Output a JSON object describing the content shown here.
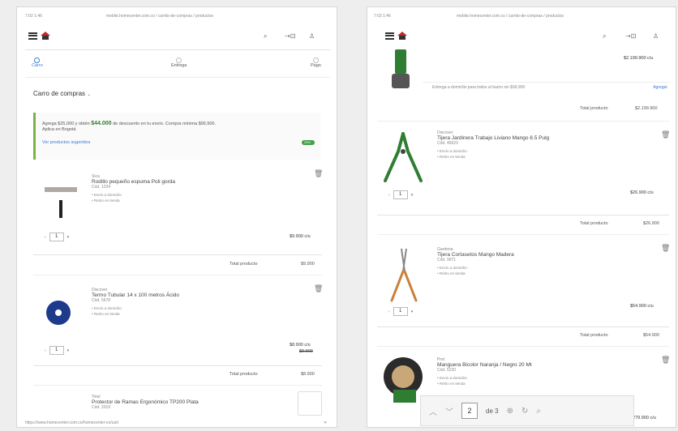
{
  "left": {
    "status": {
      "time": "7:02 1:46",
      "url": "mobile.homecenter.com.co / carrito-de-compras / productos"
    },
    "steps": [
      {
        "label": "Carro",
        "active": true
      },
      {
        "label": "Entrega"
      },
      {
        "label": "Pago"
      }
    ],
    "cart_title": "Carro de compras",
    "cart_count_icon": "chevron-down-icon",
    "promo": {
      "text_pre": "Agrega $25,000 y obtén",
      "highlight": "$44.000",
      "text_post": "de descuento en tu envío. Compra mínima $99,900.",
      "sub": "Aplica en Bogotá",
      "link": "Ver productos sugeridos",
      "badge": "25%"
    },
    "items": [
      {
        "brand": "Sica",
        "name": "Rodillo pequeño espuma Poli gorda",
        "code": "Cód. 1234",
        "bullets": [
          "Envío a domicilio",
          "Retiro en tienda"
        ],
        "qty": "1",
        "price": "$9.900 c/u",
        "total_label": "Total producto",
        "total": "$9.900"
      },
      {
        "brand": "Discover",
        "name": "Termo Tubular 14 x 100 metros Ácido",
        "code": "Cód. 5678",
        "bullets": [
          "Envío a domicilio",
          "Retiro en tienda"
        ],
        "qty": "1",
        "price": "$8.900 c/u",
        "price_old": "$9.900",
        "total_label": "Total producto",
        "total": "$8.900"
      },
      {
        "brand": "Total",
        "name": "Protector de Ramas Ergonómico TP200 Plata",
        "code": "Cód. 2019"
      }
    ],
    "footer_url": "https://www.homecenter.com.co/homecenter-co/cart"
  },
  "right": {
    "status": {
      "time": "7:02 1:46",
      "url": "mobile.homecenter.com.co / carrito-de-compras / productos"
    },
    "top_price": "$2.199.900 c/u",
    "shipping_note": "Entrega a domicilio para todos al barrio sin $99,900",
    "shipping_link": "Agregar",
    "items": [
      {
        "total_label": "Total producto",
        "total": "$2.199.900"
      },
      {
        "brand": "Discover",
        "name": "Tijera Jardinera Trabajo Liviano Mango 8.5 Pulg",
        "code": "Cód. 45623",
        "bullets": [
          "Envío a domicilio",
          "Retiro en tienda"
        ],
        "qty": "1",
        "price": "$26.900 c/u",
        "total_label": "Total producto",
        "total": "$26.900"
      },
      {
        "brand": "Gardena",
        "name": "Tijera Cortasetos Mango Madera",
        "code": "Cód. 9971",
        "bullets": [
          "Envío a domicilio",
          "Retiro en tienda"
        ],
        "qty": "1",
        "price": "$54.900 c/u",
        "total_label": "Total producto",
        "total": "$54.900"
      },
      {
        "brand": "Pret",
        "name": "Manguera Bicolor Naranja / Negro 20 Mt",
        "code": "Cód. 5220",
        "bullets": [
          "Envío a domicilio",
          "Retiro en tienda"
        ],
        "price": "$279.900 c/u"
      }
    ],
    "pdf": {
      "page": "2",
      "of": "de 3"
    }
  }
}
